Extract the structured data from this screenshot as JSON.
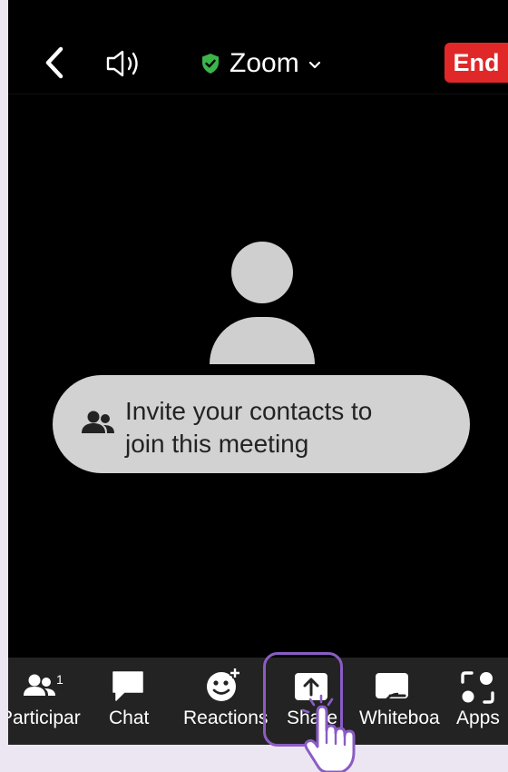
{
  "header": {
    "title": "Zoom",
    "end_label": "End"
  },
  "invite": {
    "line1": "Invite your contacts to",
    "line2": "join this meeting"
  },
  "toolbar": {
    "participants_label": "Participar",
    "participants_count": "1",
    "chat_label": "Chat",
    "reactions_label": "Reactions",
    "share_label": "Share",
    "whiteboard_label": "Whiteboa",
    "apps_label": "Apps"
  },
  "colors": {
    "end_button": "#e02828",
    "shield": "#3bb54a",
    "highlight": "#8a5cc4",
    "page_background": "#ece6f2"
  },
  "icons": [
    "back-icon",
    "speaker-icon",
    "shield-check-icon",
    "chevron-down-icon",
    "people-icon",
    "chat-bubble-icon",
    "reaction-add-icon",
    "share-upload-icon",
    "whiteboard-icon",
    "apps-icon",
    "hand-pointer-icon"
  ]
}
